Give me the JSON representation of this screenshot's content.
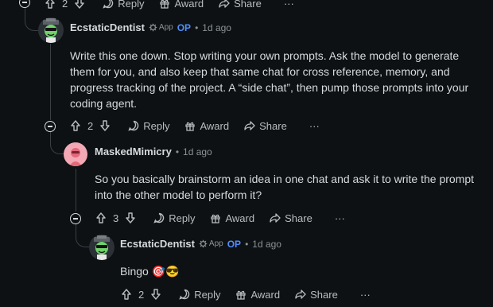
{
  "top_actions": {
    "vote_count": "2",
    "reply": "Reply",
    "award": "Award",
    "share": "Share",
    "more": "···"
  },
  "comments": [
    {
      "author": "EcstaticDentist",
      "app_label": "App",
      "op_label": "OP",
      "separator": "•",
      "time": "1d ago",
      "body": "Write this one down. Stop writing your own prompts. Ask the model to generate them for you, and also keep that same chat for cross reference, memory, and progress tracking of the project. A “side chat”, then pump those prompts into your coding agent.",
      "vote_count": "2",
      "reply": "Reply",
      "award": "Award",
      "share": "Share",
      "more": "···"
    },
    {
      "author": "MaskedMimicry",
      "separator": "•",
      "time": "1d ago",
      "body": "So you basically brainstorm an idea in one chat and ask it to write the prompt into the other model to perform it?",
      "vote_count": "3",
      "reply": "Reply",
      "award": "Award",
      "share": "Share",
      "more": "···"
    },
    {
      "author": "EcstaticDentist",
      "app_label": "App",
      "op_label": "OP",
      "separator": "•",
      "time": "1d ago",
      "body": "Bingo 🎯😎",
      "vote_count": "2",
      "reply": "Reply",
      "award": "Award",
      "share": "Share",
      "more": "···"
    }
  ],
  "colors": {
    "background": "#0e1113",
    "text": "#d7dadc",
    "muted": "#8a9195",
    "op": "#4d8eff",
    "thread": "#3a3f44"
  }
}
